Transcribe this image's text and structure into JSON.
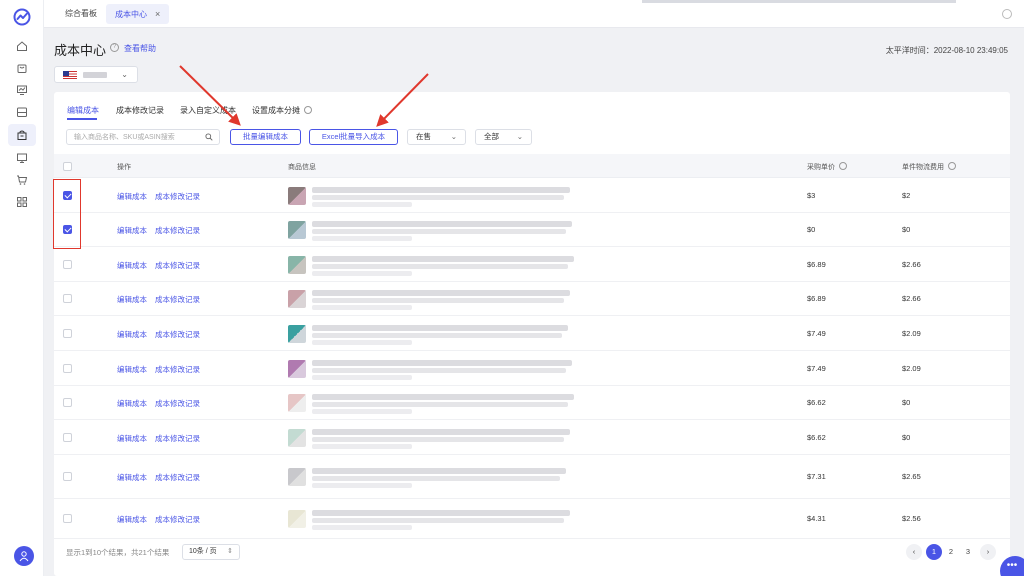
{
  "colors": {
    "accent": "#4a55e6",
    "annotation": "#e0382d"
  },
  "rail": {
    "logo": "brand-logo-icon",
    "items": [
      {
        "icon": "home-icon"
      },
      {
        "icon": "bag-icon"
      },
      {
        "icon": "chart-monitor-icon"
      },
      {
        "icon": "inbox-icon"
      },
      {
        "icon": "shop-icon",
        "active": true
      },
      {
        "icon": "desktop-icon"
      },
      {
        "icon": "cart-icon"
      },
      {
        "icon": "apps-icon"
      }
    ],
    "avatar": "user-icon"
  },
  "topbar": {
    "tabs": [
      {
        "label": "综合看板"
      },
      {
        "label": "成本中心",
        "active": true,
        "close": "×"
      }
    ]
  },
  "header": {
    "title": "成本中心",
    "help_icon": "?",
    "help_link": "查看帮助",
    "time": "太平洋时间：2022-08-10 23:49:05",
    "market_caret": "⌄"
  },
  "tabs": [
    {
      "label": "编辑成本",
      "active": true
    },
    {
      "label": "成本修改记录"
    },
    {
      "label": "录入自定义成本"
    },
    {
      "label": "设置成本分摊",
      "info": true
    }
  ],
  "toolbar": {
    "search_placeholder": "输入商品名称、SKU或ASIN搜索",
    "batch_edit": "批量编辑成本",
    "excel_import": "Excel批量导入成本",
    "status_filter": "在售",
    "scope_filter": "全部"
  },
  "table": {
    "headers": {
      "operation": "操作",
      "product": "商品信息",
      "unit_cost": "采购单价",
      "shipping": "单件物流费用"
    },
    "action_edit": "编辑成本",
    "action_log": "成本修改记录",
    "rows": [
      {
        "checked": true,
        "unit_cost": "$3",
        "shipping": "$2"
      },
      {
        "checked": true,
        "unit_cost": "$0",
        "shipping": "$0"
      },
      {
        "checked": false,
        "unit_cost": "$6.89",
        "shipping": "$2.66"
      },
      {
        "checked": false,
        "unit_cost": "$6.89",
        "shipping": "$2.66"
      },
      {
        "checked": false,
        "unit_cost": "$7.49",
        "shipping": "$2.09"
      },
      {
        "checked": false,
        "unit_cost": "$7.49",
        "shipping": "$2.09"
      },
      {
        "checked": false,
        "unit_cost": "$6.62",
        "shipping": "$0"
      },
      {
        "checked": false,
        "unit_cost": "$6.62",
        "shipping": "$0"
      },
      {
        "checked": false,
        "unit_cost": "$7.31",
        "shipping": "$2.65"
      },
      {
        "checked": false,
        "unit_cost": "$4.31",
        "shipping": "$2.56"
      }
    ]
  },
  "footer": {
    "summary": "显示1到10个结果，共21个结果",
    "page_size": "10条 / 页",
    "prev": "‹",
    "pages": [
      "1",
      "2",
      "3"
    ],
    "current_page": "1",
    "next": "›"
  },
  "chat_bubble": "•••"
}
